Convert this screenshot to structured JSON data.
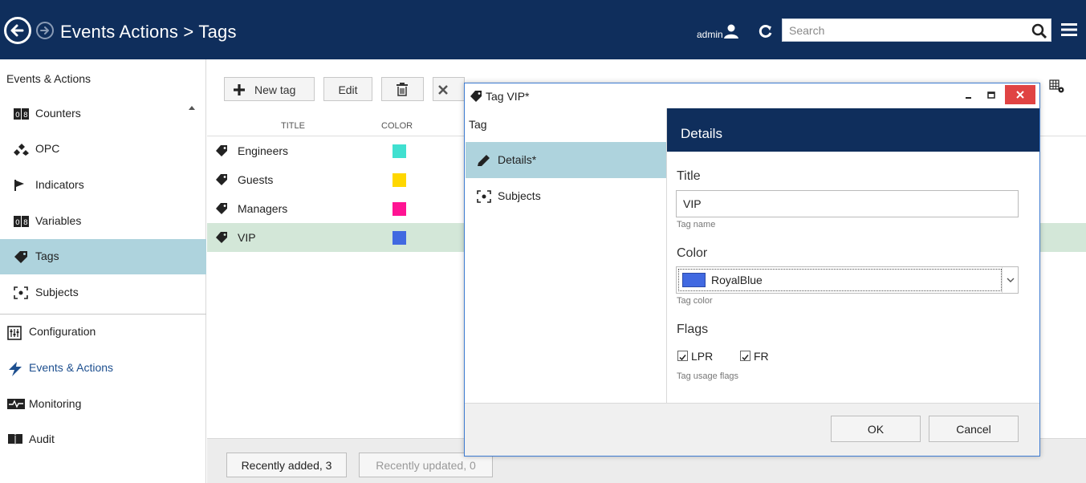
{
  "header": {
    "title": "Events  Actions > Tags",
    "user": "admin",
    "search_placeholder": "Search"
  },
  "sidebar": {
    "section_title": "Events & Actions",
    "items": [
      {
        "label": "Counters",
        "icon": "counter-icon"
      },
      {
        "label": "OPC",
        "icon": "opc-icon"
      },
      {
        "label": "Indicators",
        "icon": "flag-icon"
      },
      {
        "label": "Variables",
        "icon": "variables-icon"
      },
      {
        "label": "Tags",
        "icon": "tag-icon",
        "active": true
      },
      {
        "label": "Subjects",
        "icon": "subjects-icon"
      }
    ],
    "nav": [
      {
        "label": "Configuration",
        "icon": "configuration-icon"
      },
      {
        "label": "Events & Actions",
        "icon": "lightning-icon"
      },
      {
        "label": "Monitoring",
        "icon": "monitoring-icon"
      },
      {
        "label": "Audit",
        "icon": "audit-icon"
      }
    ]
  },
  "toolbar": {
    "new_tag": "New tag",
    "edit": "Edit"
  },
  "table": {
    "columns": [
      "TITLE",
      "COLOR"
    ],
    "rows": [
      {
        "title": "Engineers",
        "color": "#40e0d0"
      },
      {
        "title": "Guests",
        "color": "#ffd700"
      },
      {
        "title": "Managers",
        "color": "#ff1493"
      },
      {
        "title": "VIP",
        "color": "#4169e1",
        "selected": true
      }
    ]
  },
  "bottom": {
    "recently_added": "Recently added, 3",
    "recently_updated": "Recently updated, 0"
  },
  "dialog": {
    "title": "Tag VIP*",
    "left_header": "Tag",
    "nav": [
      {
        "label": "Details*",
        "icon": "pencil-icon",
        "active": true
      },
      {
        "label": "Subjects",
        "icon": "subjects-icon"
      }
    ],
    "section_title": "Details",
    "fields": {
      "title_label": "Title",
      "title_value": "VIP",
      "title_hint": "Tag name",
      "color_label": "Color",
      "color_value": "RoyalBlue",
      "color_swatch": "#4169e1",
      "color_hint": "Tag color",
      "flags_label": "Flags",
      "flag_lpr": "LPR",
      "flag_fr": "FR",
      "flags_hint": "Tag usage flags"
    },
    "ok": "OK",
    "cancel": "Cancel"
  },
  "colors": {
    "header_bg": "#0f2e5c",
    "active_bg": "#aed3dd",
    "selected_row_bg": "#d3e7d8",
    "close_red": "#e04343"
  }
}
